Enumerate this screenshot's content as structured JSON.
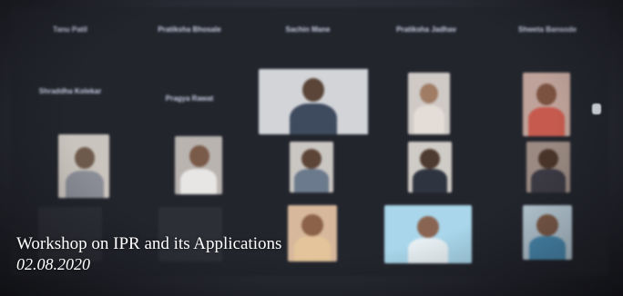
{
  "caption": {
    "title": "Workshop on IPR and its Applications",
    "date": "02.08.2020"
  },
  "participants": [
    {
      "name": "Tanu Patil",
      "video": false
    },
    {
      "name": "Pratiksha Bhosale",
      "video": false
    },
    {
      "name": "Sachin Mane",
      "video": false
    },
    {
      "name": "Pratiksha Jadhav",
      "video": false
    },
    {
      "name": "Shweta Bansode",
      "video": false
    },
    {
      "name": "Shraddha Kolekar",
      "video": true
    },
    {
      "name": "Pragya Rawat",
      "video": false
    },
    {
      "name": "",
      "video": true
    },
    {
      "name": "",
      "video": true
    },
    {
      "name": "",
      "video": true
    },
    {
      "name": "",
      "video": true
    },
    {
      "name": "",
      "video": true
    },
    {
      "name": "",
      "video": true
    },
    {
      "name": "",
      "video": true
    },
    {
      "name": "",
      "video": true
    },
    {
      "name": "",
      "video": true
    },
    {
      "name": "",
      "video": true
    },
    {
      "name": "",
      "video": true
    },
    {
      "name": "",
      "video": true
    }
  ]
}
